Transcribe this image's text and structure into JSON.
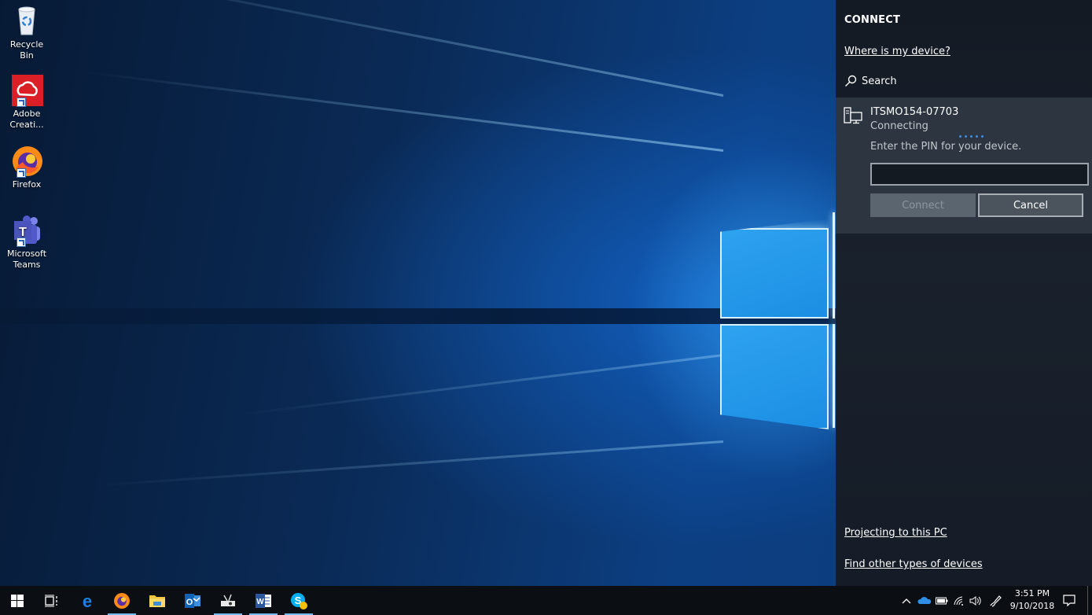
{
  "desktop": {
    "icons": [
      {
        "label": "Recycle Bin",
        "icon": "recycle-bin-icon"
      },
      {
        "label": "Adobe Creati...",
        "icon": "adobe-creative-cloud-icon"
      },
      {
        "label": "Firefox",
        "icon": "firefox-icon"
      },
      {
        "label": "Microsoft Teams",
        "icon": "microsoft-teams-icon"
      }
    ]
  },
  "connect_panel": {
    "title": "CONNECT",
    "where_link": "Where is my device?",
    "search_label": "Search",
    "device": {
      "name": "ITSMO154-07703",
      "status": "Connecting",
      "prompt": "Enter the PIN for your device.",
      "pin_value": "",
      "connect_label": "Connect",
      "cancel_label": "Cancel"
    },
    "projecting_link": "Projecting to this PC",
    "find_link": "Find other types of devices"
  },
  "taskbar": {
    "apps": [
      {
        "name": "start",
        "icon": "windows-start-icon"
      },
      {
        "name": "task-view",
        "icon": "task-view-icon"
      },
      {
        "name": "edge",
        "icon": "edge-icon"
      },
      {
        "name": "firefox",
        "icon": "firefox-icon",
        "active": true
      },
      {
        "name": "file-explorer",
        "icon": "folder-icon"
      },
      {
        "name": "outlook",
        "icon": "outlook-icon"
      },
      {
        "name": "projector-app",
        "icon": "projector-icon",
        "active": true
      },
      {
        "name": "word",
        "icon": "word-icon",
        "active": true
      },
      {
        "name": "skype",
        "icon": "skype-icon",
        "active": true
      }
    ],
    "tray": {
      "time": "3:51 PM",
      "date": "9/10/2018"
    }
  },
  "colors": {
    "panel_bg": "#161d27",
    "device_bg": "#2c3540",
    "accent": "#3b8fe0",
    "taskbar_bg": "#0b0f14"
  }
}
